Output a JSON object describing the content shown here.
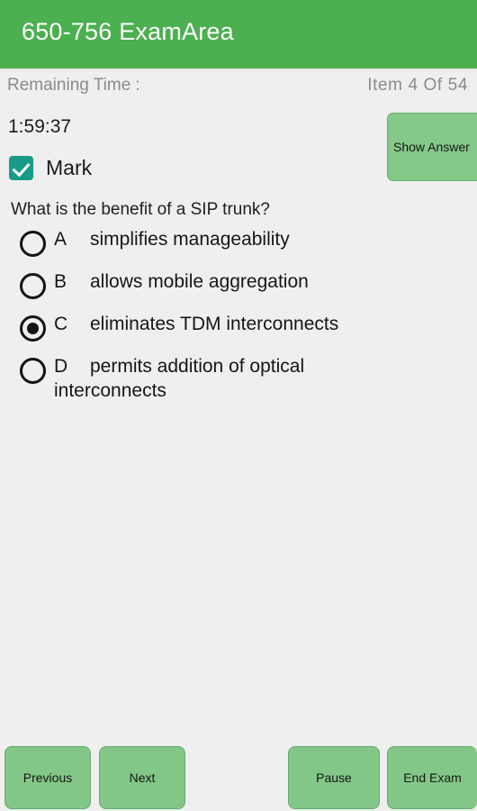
{
  "appbar": {
    "title": "650-756 ExamArea",
    "background_color": "#4caf50",
    "title_color": "#ffffff"
  },
  "info": {
    "remaining_time_label": "Remaining Time :",
    "item_counter": "Item 4 Of 54",
    "timer_value": "1:59:37"
  },
  "actions": {
    "show_answer_label": "Show Answer"
  },
  "mark": {
    "label": "Mark",
    "checked": true,
    "checkbox_color": "#1a9b8a"
  },
  "question": {
    "text": "What is the benefit of a SIP trunk?",
    "options": [
      {
        "letter": "A",
        "text": "simplifies manageability",
        "selected": false
      },
      {
        "letter": "B",
        "text": "allows mobile aggregation",
        "selected": false
      },
      {
        "letter": "C",
        "text": "eliminates TDM interconnects",
        "selected": true
      },
      {
        "letter": "D",
        "text": "permits addition of optical interconnects",
        "selected": false
      }
    ]
  },
  "bottom_bar": {
    "previous_label": "Previous",
    "next_label": "Next",
    "pause_label": "Pause",
    "end_exam_label": "End Exam",
    "button_color": "#82c787"
  }
}
